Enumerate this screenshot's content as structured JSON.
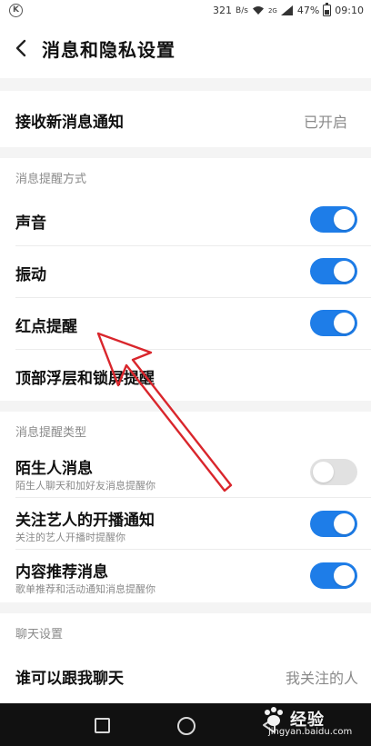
{
  "status_bar": {
    "left_badge": "K",
    "speed": "321",
    "speed_unit": "B/s",
    "network": "2G",
    "battery_percent": "47%",
    "battery_level": 0.47,
    "time": "09:10"
  },
  "app_bar": {
    "title": "消息和隐私设置"
  },
  "receive_notify": {
    "label": "接收新消息通知",
    "value": "已开启"
  },
  "reminder_mode": {
    "header": "消息提醒方式",
    "items": [
      {
        "label": "声音",
        "on": true
      },
      {
        "label": "振动",
        "on": true
      },
      {
        "label": "红点提醒",
        "on": true
      }
    ],
    "top_float_label": "顶部浮层和锁屏提醒"
  },
  "reminder_type": {
    "header": "消息提醒类型",
    "items": [
      {
        "label": "陌生人消息",
        "sub": "陌生人聊天和加好友消息提醒你",
        "on": false
      },
      {
        "label": "关注艺人的开播通知",
        "sub": "关注的艺人开播时提醒你",
        "on": true
      },
      {
        "label": "内容推荐消息",
        "sub": "歌单推荐和活动通知消息提醒你",
        "on": true
      }
    ]
  },
  "chat": {
    "header": "聊天设置",
    "who_can_chat_label": "谁可以跟我聊天",
    "who_can_chat_value": "我关注的人"
  },
  "watermark": {
    "brand": "经验",
    "url": "jingyan.baidu.com"
  },
  "colors": {
    "accent": "#1e7de8",
    "toggle_off": "#e1e1e1",
    "annotation_arrow": "#d9262c"
  }
}
